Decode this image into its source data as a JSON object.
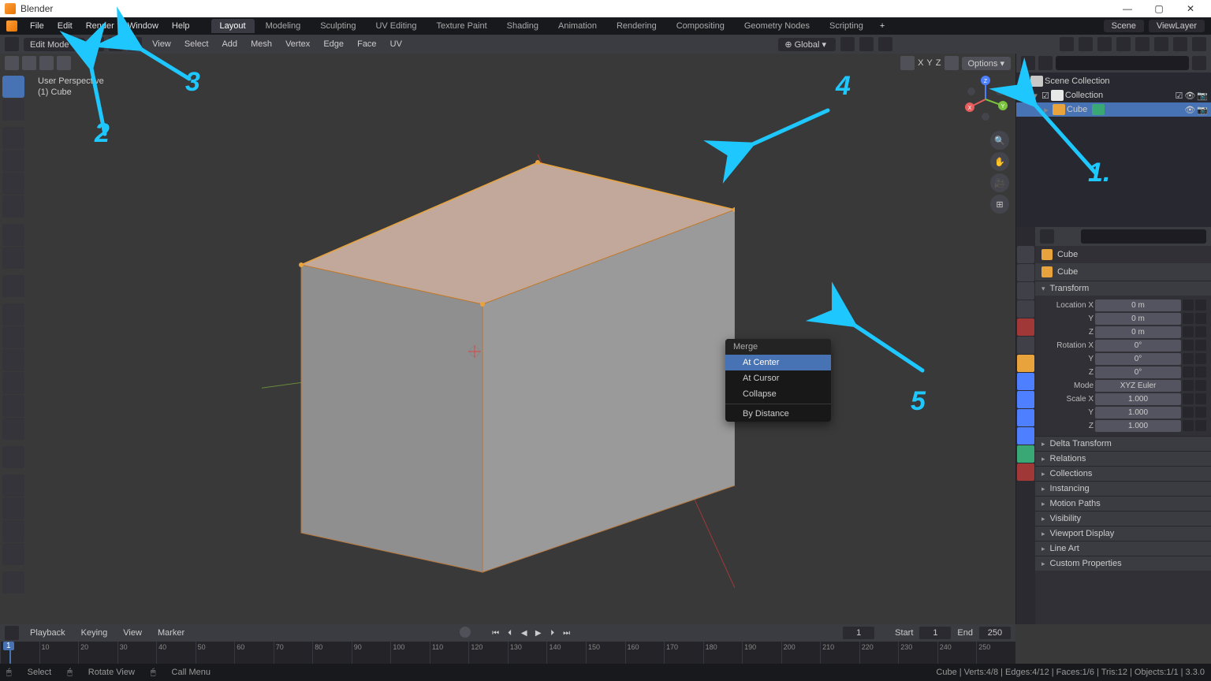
{
  "app_title": "Blender",
  "top_menus": [
    "File",
    "Edit",
    "Render",
    "Window",
    "Help"
  ],
  "workspaces": [
    "Layout",
    "Modeling",
    "Sculpting",
    "UV Editing",
    "Texture Paint",
    "Shading",
    "Animation",
    "Rendering",
    "Compositing",
    "Geometry Nodes",
    "Scripting"
  ],
  "workspace_active": "Layout",
  "scene_name": "Scene",
  "viewlayer_name": "ViewLayer",
  "header": {
    "mode": "Edit Mode",
    "menus": [
      "View",
      "Select",
      "Add",
      "Mesh",
      "Vertex",
      "Edge",
      "Face",
      "UV"
    ],
    "orientation": "Global",
    "options": "Options"
  },
  "viewport": {
    "label_line1": "User Perspective",
    "label_line2": "(1) Cube",
    "axes": [
      "X",
      "Y",
      "Z"
    ]
  },
  "context_menu": {
    "title": "Merge",
    "items": [
      "At Center",
      "At Cursor",
      "Collapse"
    ],
    "items2": [
      "By Distance"
    ],
    "highlighted": "At Center"
  },
  "outliner": {
    "rows": [
      {
        "label": "Scene Collection",
        "indent": 0,
        "icon": "#c8c8c8"
      },
      {
        "label": "Collection",
        "indent": 1,
        "icon": "#e8e8e8"
      },
      {
        "label": "Cube",
        "indent": 2,
        "icon": "#e8a33d",
        "selected": true
      }
    ]
  },
  "properties": {
    "crumb1": "Cube",
    "crumb2": "Cube",
    "transform_label": "Transform",
    "rows": [
      {
        "label": "Location X",
        "value": "0 m"
      },
      {
        "label": "Y",
        "value": "0 m"
      },
      {
        "label": "Z",
        "value": "0 m"
      },
      {
        "label": "Rotation X",
        "value": "0°"
      },
      {
        "label": "Y",
        "value": "0°"
      },
      {
        "label": "Z",
        "value": "0°"
      },
      {
        "label": "Mode",
        "value": "XYZ Euler"
      },
      {
        "label": "Scale X",
        "value": "1.000"
      },
      {
        "label": "Y",
        "value": "1.000"
      },
      {
        "label": "Z",
        "value": "1.000"
      }
    ],
    "panels": [
      "Delta Transform",
      "Relations",
      "Collections",
      "Instancing",
      "Motion Paths",
      "Visibility",
      "Viewport Display",
      "Line Art",
      "Custom Properties"
    ]
  },
  "timeline": {
    "menus": [
      "Playback",
      "Keying",
      "View",
      "Marker"
    ],
    "frame": "1",
    "start_label": "Start",
    "start_val": "1",
    "end_label": "End",
    "end_val": "250",
    "ticks": [
      "",
      "10",
      "20",
      "30",
      "40",
      "50",
      "60",
      "70",
      "80",
      "90",
      "100",
      "110",
      "120",
      "130",
      "140",
      "150",
      "160",
      "170",
      "180",
      "190",
      "200",
      "210",
      "220",
      "230",
      "240",
      "250"
    ]
  },
  "status": {
    "left": [
      "Select",
      "Rotate View",
      "Call Menu"
    ],
    "right": "Cube | Verts:4/8 | Edges:4/12 | Faces:1/6 | Tris:12 | Objects:1/1 | 3.3.0"
  },
  "annotations": [
    "1.",
    "2",
    "3",
    "4",
    "5"
  ]
}
